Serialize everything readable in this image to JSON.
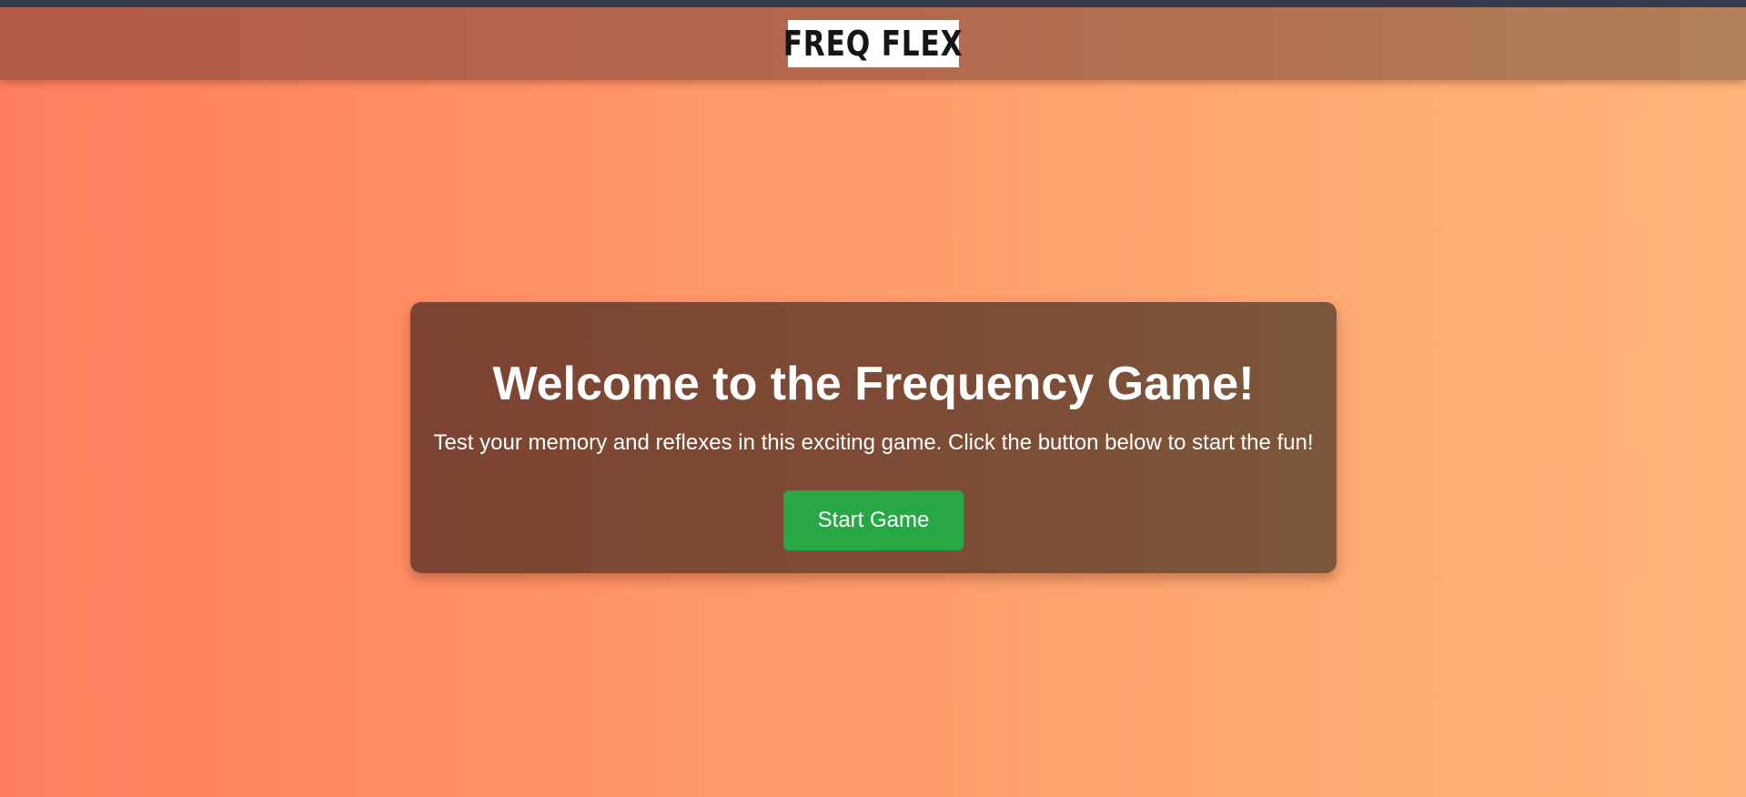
{
  "header": {
    "logo_text": "FREQ FLEX"
  },
  "welcome": {
    "title": "Welcome to the Frequency Game!",
    "description": "Test your memory and reflexes in this exciting game. Click the button below to start the fun!",
    "start_button_label": "Start Game"
  },
  "colors": {
    "background_gradient_start": "#ff7f5e",
    "background_gradient_end": "#ffb47a",
    "header_bar": "#b3684d",
    "card_background": "#7d4c36",
    "start_button": "#27a844"
  }
}
